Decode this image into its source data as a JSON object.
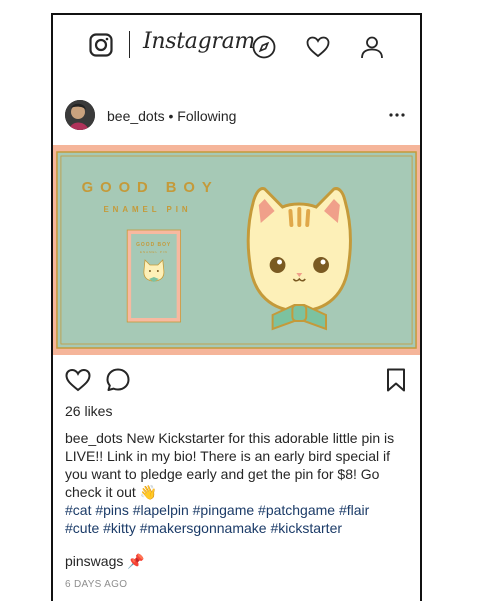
{
  "app": {
    "wordmark": "Instagram"
  },
  "colors": {
    "pin_background": "#a6c9b6",
    "pin_border": "#f5b59a",
    "pin_gold": "#c49a3a",
    "cat_fill": "#fdf0b8",
    "bowtie": "#7cc2a0"
  },
  "nav": {
    "icons": [
      "instagram-camera-icon",
      "compass-icon",
      "heart-icon",
      "profile-icon"
    ]
  },
  "post": {
    "username": "bee_dots",
    "separator": " • ",
    "follow_status": "Following",
    "more_icon": "more-options-icon",
    "image": {
      "headline": "GOOD BOY",
      "subhead": "ENAMEL PIN",
      "card_headline": "GOOD BOY",
      "card_subhead": "ENAMEL PIN"
    },
    "likes": "26 likes",
    "caption_user": "bee_dots",
    "caption_text": " New Kickstarter for this adorable little pin is LIVE!! Link in my bio! There is an early bird special if you want to pledge early and get the pin for $8! Go check it out 👋",
    "hashtags": "#cat #pins #lapelpin #pingame #patchgame #flair #cute #kitty #makersgonnamake #kickstarter",
    "comment_user": "pinswags",
    "comment_emoji": "📌",
    "time_ago": "6 DAYS AGO"
  }
}
